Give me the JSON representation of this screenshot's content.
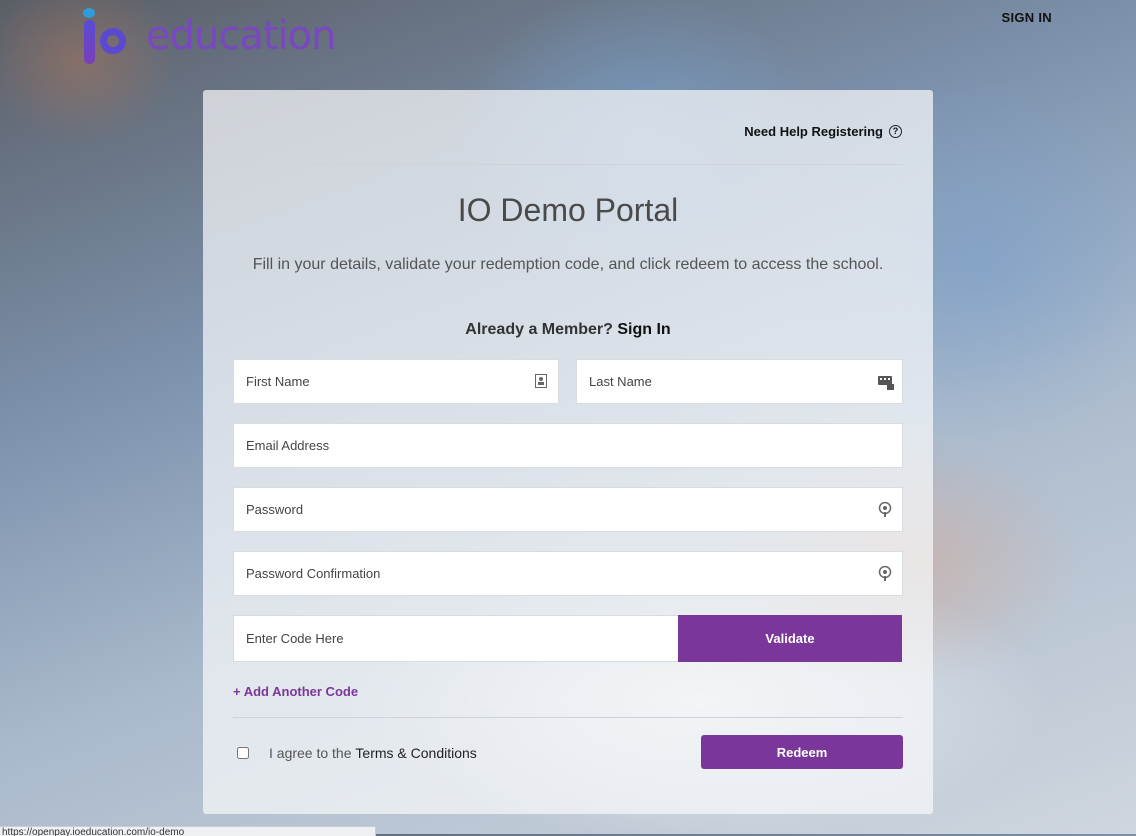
{
  "header": {
    "logo_text": "education",
    "signin_label": "SIGN IN"
  },
  "panel": {
    "help_label": "Need Help Registering",
    "title": "IO Demo Portal",
    "subtitle": "Fill in your details, validate your redemption code, and click redeem to access the school.",
    "member_prefix": "Already a Member?",
    "member_link": "Sign In"
  },
  "form": {
    "first_name_placeholder": "First Name",
    "last_name_placeholder": "Last Name",
    "email_placeholder": "Email Address",
    "password_placeholder": "Password",
    "password_confirm_placeholder": "Password Confirmation",
    "code_placeholder": "Enter Code Here",
    "validate_label": "Validate",
    "add_code_label": "+ Add Another Code",
    "agree_prefix": "I agree to the",
    "terms_label": "Terms & Conditions",
    "redeem_label": "Redeem"
  },
  "status_bar": {
    "url_text": "https://openpay.ioeducation.com/io-demo"
  },
  "colors": {
    "accent": "#7a3799",
    "logo": "#7a46c2"
  }
}
